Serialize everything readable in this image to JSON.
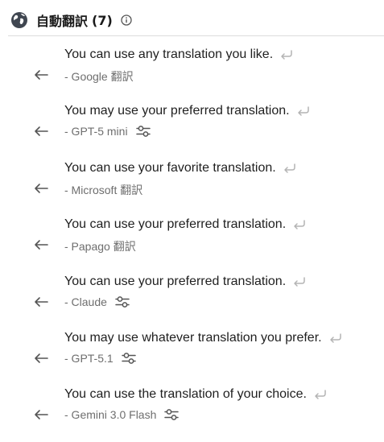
{
  "header": {
    "title": "自動翻訳",
    "count": "(7)",
    "icons": [
      "globe-icon",
      "info-icon"
    ]
  },
  "entries": [
    {
      "text": "You can use any translation you like.",
      "source": "- Google 翻訳",
      "has_settings": false
    },
    {
      "text": "You may use your preferred translation.",
      "source": "- GPT-5 mini",
      "has_settings": true
    },
    {
      "text": "You can use your favorite translation.",
      "source": "- Microsoft 翻訳",
      "has_settings": false
    },
    {
      "text": "You can use your preferred translation.",
      "source": "- Papago 翻訳",
      "has_settings": false
    },
    {
      "text": "You can use your preferred translation.",
      "source": "- Claude",
      "has_settings": true
    },
    {
      "text": "You may use whatever translation you prefer.",
      "source": "- GPT-5.1",
      "has_settings": true
    },
    {
      "text": "You can use the translation of your choice.",
      "source": "- Gemini 3.0 Flash",
      "has_settings": true
    }
  ],
  "icons": {
    "use": "arrow-left-icon",
    "insert": "return-arrow-icon",
    "settings": "sliders-icon"
  },
  "colors": {
    "text": "#1f1f1f",
    "source": "#6e6e6e",
    "icon": "#555555",
    "icon_light": "#b4b4b4"
  }
}
